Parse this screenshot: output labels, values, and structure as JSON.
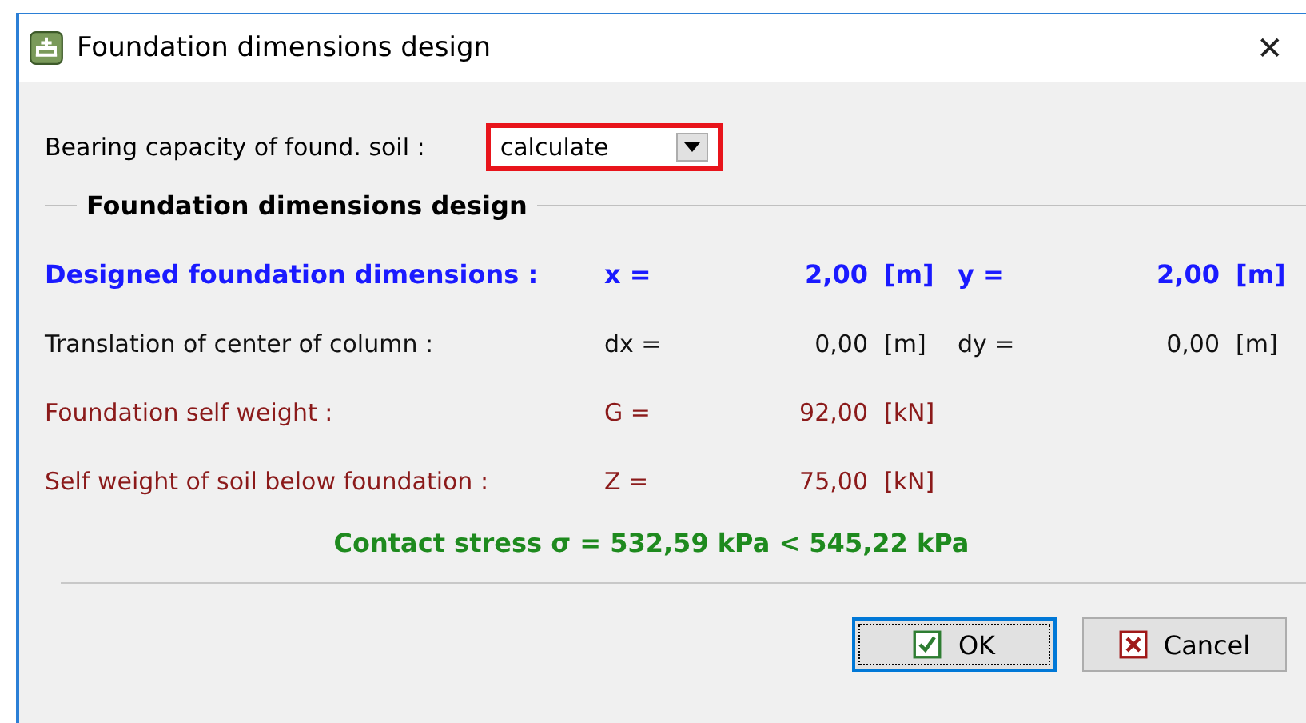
{
  "window": {
    "title": "Foundation dimensions design",
    "close": "✕"
  },
  "bearing": {
    "label": "Bearing capacity of found. soil :",
    "value": "calculate"
  },
  "group": {
    "title": "Foundation dimensions design"
  },
  "rows": [
    {
      "kind": "result",
      "label": "Designed foundation dimensions :",
      "sym1": "x =",
      "val1": "2,00",
      "unit1": "[m]",
      "sym2": "y =",
      "val2": "2,00",
      "unit2": "[m]"
    },
    {
      "kind": "input",
      "label": "Translation of center of column :",
      "sym1": "dx =",
      "val1": "0,00",
      "unit1": "[m]",
      "sym2": "dy =",
      "val2": "0,00",
      "unit2": "[m]"
    },
    {
      "kind": "computed",
      "label": "Foundation self weight :",
      "sym1": "G =",
      "val1": "92,00",
      "unit1": "[kN]"
    },
    {
      "kind": "computed",
      "label": "Self weight of soil below foundation :",
      "sym1": "Z =",
      "val1": "75,00",
      "unit1": "[kN]"
    }
  ],
  "verdict": {
    "kind": "ok",
    "text": "Contact stress σ = 532,59 kPa < 545,22 kPa"
  },
  "buttons": [
    {
      "kind": "ok",
      "label": "OK",
      "focused": true
    },
    {
      "kind": "cancel",
      "label": "Cancel",
      "focused": false
    }
  ]
}
